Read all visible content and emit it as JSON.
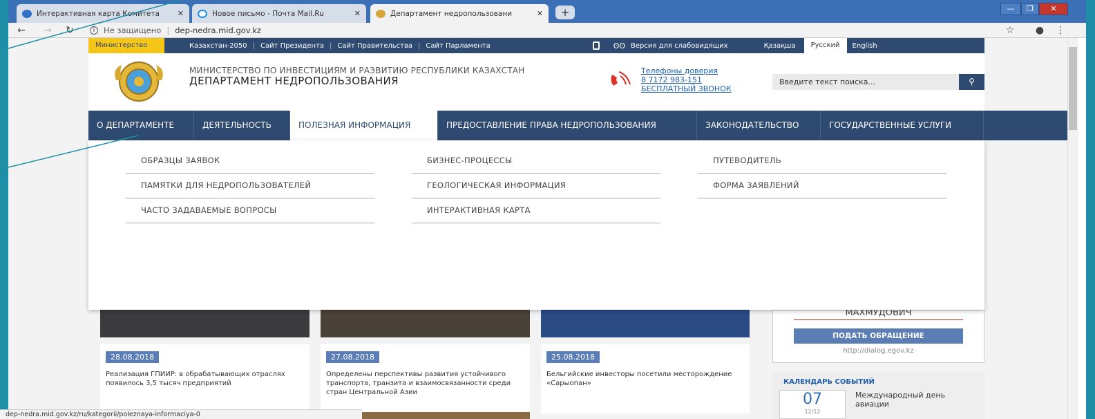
{
  "browser": {
    "tabs": [
      {
        "label": "Интерактивная карта Комитета",
        "icon": "map-favicon-icon",
        "active": false
      },
      {
        "label": "Новое письмо - Почта Mail.Ru",
        "icon": "mail-favicon-icon",
        "active": false
      },
      {
        "label": "Департамент недропользовани",
        "icon": "emblem-favicon-icon",
        "active": true
      }
    ],
    "close_glyph": "✕",
    "new_tab_glyph": "+",
    "window_buttons": [
      "—",
      "❐",
      "✕"
    ],
    "security": "Не защищено",
    "url": "dep-nedra.mid.gov.kz",
    "status_url": "dep-nedra.mid.gov.kz/ru/kategorii/poleznaya-informaciya-0"
  },
  "topbar": {
    "ministry": "Министерство",
    "links": [
      "Казахстан-2050",
      "Сайт Президента",
      "Сайт Правительства",
      "Сайт Парламента"
    ],
    "accessibility": "Версия для слабовидящих",
    "languages": [
      "Қазақша",
      "Русский",
      "English"
    ],
    "active_language": "Русский"
  },
  "header": {
    "ministry_name": "МИНИСТЕРСТВО ПО ИНВЕСТИЦИЯМ И РАЗВИТИЮ РЕСПУБЛИКИ КАЗАХСТАН",
    "department_name": "ДЕПАРТАМЕНТ НЕДРОПОЛЬЗОВАНИЯ",
    "hotline_title": "Телефоны доверия",
    "hotline_phone": "8 7172 983-151",
    "hotline_free": "БЕСПЛАТНЫЙ ЗВОНОК",
    "search_placeholder": "Введите текст поиска..."
  },
  "nav": [
    {
      "label": "О ДЕПАРТАМЕНТЕ"
    },
    {
      "label": "ДЕЯТЕЛЬНОСТЬ"
    },
    {
      "label": "ПОЛЕЗНАЯ ИНФОРМАЦИЯ",
      "active": true
    },
    {
      "label": "ПРЕДОСТАВЛЕНИЕ ПРАВА НЕДРОПОЛЬЗОВАНИЯ"
    },
    {
      "label": "ЗАКОНОДАТЕЛЬСТВО"
    },
    {
      "label": "ГОСУДАРСТВЕННЫЕ УСЛУГИ"
    }
  ],
  "dropdown": {
    "col1": [
      "ОБРАЗЦЫ ЗАЯВОК",
      "ПАМЯТКИ ДЛЯ НЕДРОПОЛЬЗОВАТЕЛЕЙ",
      "ЧАСТО ЗАДАВАЕМЫЕ ВОПРОСЫ"
    ],
    "col2": [
      "БИЗНЕС-ПРОЦЕССЫ",
      "ГЕОЛОГИЧЕСКАЯ ИНФОРМАЦИЯ",
      "ИНТЕРАКТИВНАЯ КАРТА"
    ],
    "col3": [
      "ПУТЕВОДИТЕЛЬ",
      "ФОРМА ЗАЯВЛЕНИЙ"
    ]
  },
  "news": [
    {
      "date": "28.08.2018",
      "text": "Реализация ГПИИР: в обрабатывающих отраслях появилось 3,5 тысяч предприятий"
    },
    {
      "date": "27.08.2018",
      "text": "Определены перспективы развития устойчивого транспорта, транзита и взаимосвязанности среди стран Центральной Азии"
    },
    {
      "date": "25.08.2018",
      "text": "Бельгийские инвесторы посетили месторождение «Сарыопан»"
    }
  ],
  "side": {
    "name": "МАХМУДОВИЧ",
    "button": "ПОДАТЬ ОБРАЩЕНИЕ",
    "link": "http://dialog.egov.kz"
  },
  "calendar": {
    "title": "КАЛЕНДАРЬ СОБЫТИЙ",
    "day": "07",
    "month": "12/12",
    "event": "Международный день авиации"
  },
  "colors": {
    "navy": "#2f4a70",
    "yellow": "#f5c518",
    "date_blue": "#5b7db6",
    "frame": "#1e8fa7"
  }
}
